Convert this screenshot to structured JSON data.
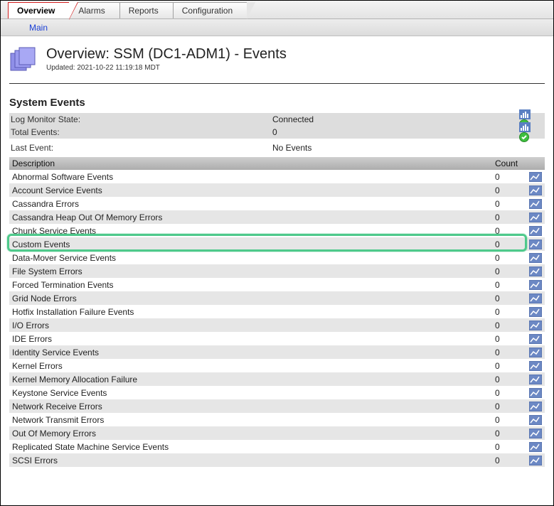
{
  "tabs": [
    "Overview",
    "Alarms",
    "Reports",
    "Configuration"
  ],
  "activeTab": 0,
  "subtab": "Main",
  "page": {
    "title": "Overview: SSM (DC1-ADM1) - Events",
    "updated_label": "Updated: 2021-10-22 11:19:18 MDT"
  },
  "section_title": "System Events",
  "summary": {
    "log_monitor_state_label": "Log Monitor State:",
    "log_monitor_state_value": "Connected",
    "total_events_label": "Total Events:",
    "total_events_value": "0",
    "last_event_label": "Last Event:",
    "last_event_value": "No Events"
  },
  "table": {
    "headers": {
      "description": "Description",
      "count": "Count"
    },
    "rows": [
      {
        "description": "Abnormal Software Events",
        "count": "0"
      },
      {
        "description": "Account Service Events",
        "count": "0"
      },
      {
        "description": "Cassandra Errors",
        "count": "0"
      },
      {
        "description": "Cassandra Heap Out Of Memory Errors",
        "count": "0"
      },
      {
        "description": "Chunk Service Events",
        "count": "0"
      },
      {
        "description": "Custom Events",
        "count": "0",
        "highlighted": true
      },
      {
        "description": "Data-Mover Service Events",
        "count": "0"
      },
      {
        "description": "File System Errors",
        "count": "0"
      },
      {
        "description": "Forced Termination Events",
        "count": "0"
      },
      {
        "description": "Grid Node Errors",
        "count": "0"
      },
      {
        "description": "Hotfix Installation Failure Events",
        "count": "0"
      },
      {
        "description": "I/O Errors",
        "count": "0"
      },
      {
        "description": "IDE Errors",
        "count": "0"
      },
      {
        "description": "Identity Service Events",
        "count": "0"
      },
      {
        "description": "Kernel Errors",
        "count": "0"
      },
      {
        "description": "Kernel Memory Allocation Failure",
        "count": "0"
      },
      {
        "description": "Keystone Service Events",
        "count": "0"
      },
      {
        "description": "Network Receive Errors",
        "count": "0"
      },
      {
        "description": "Network Transmit Errors",
        "count": "0"
      },
      {
        "description": "Out Of Memory Errors",
        "count": "0"
      },
      {
        "description": "Replicated State Machine Service Events",
        "count": "0"
      },
      {
        "description": "SCSI Errors",
        "count": "0"
      }
    ]
  },
  "icons": {
    "status_ok": "ok",
    "chart": "chart",
    "page_stack": "page-stack"
  }
}
